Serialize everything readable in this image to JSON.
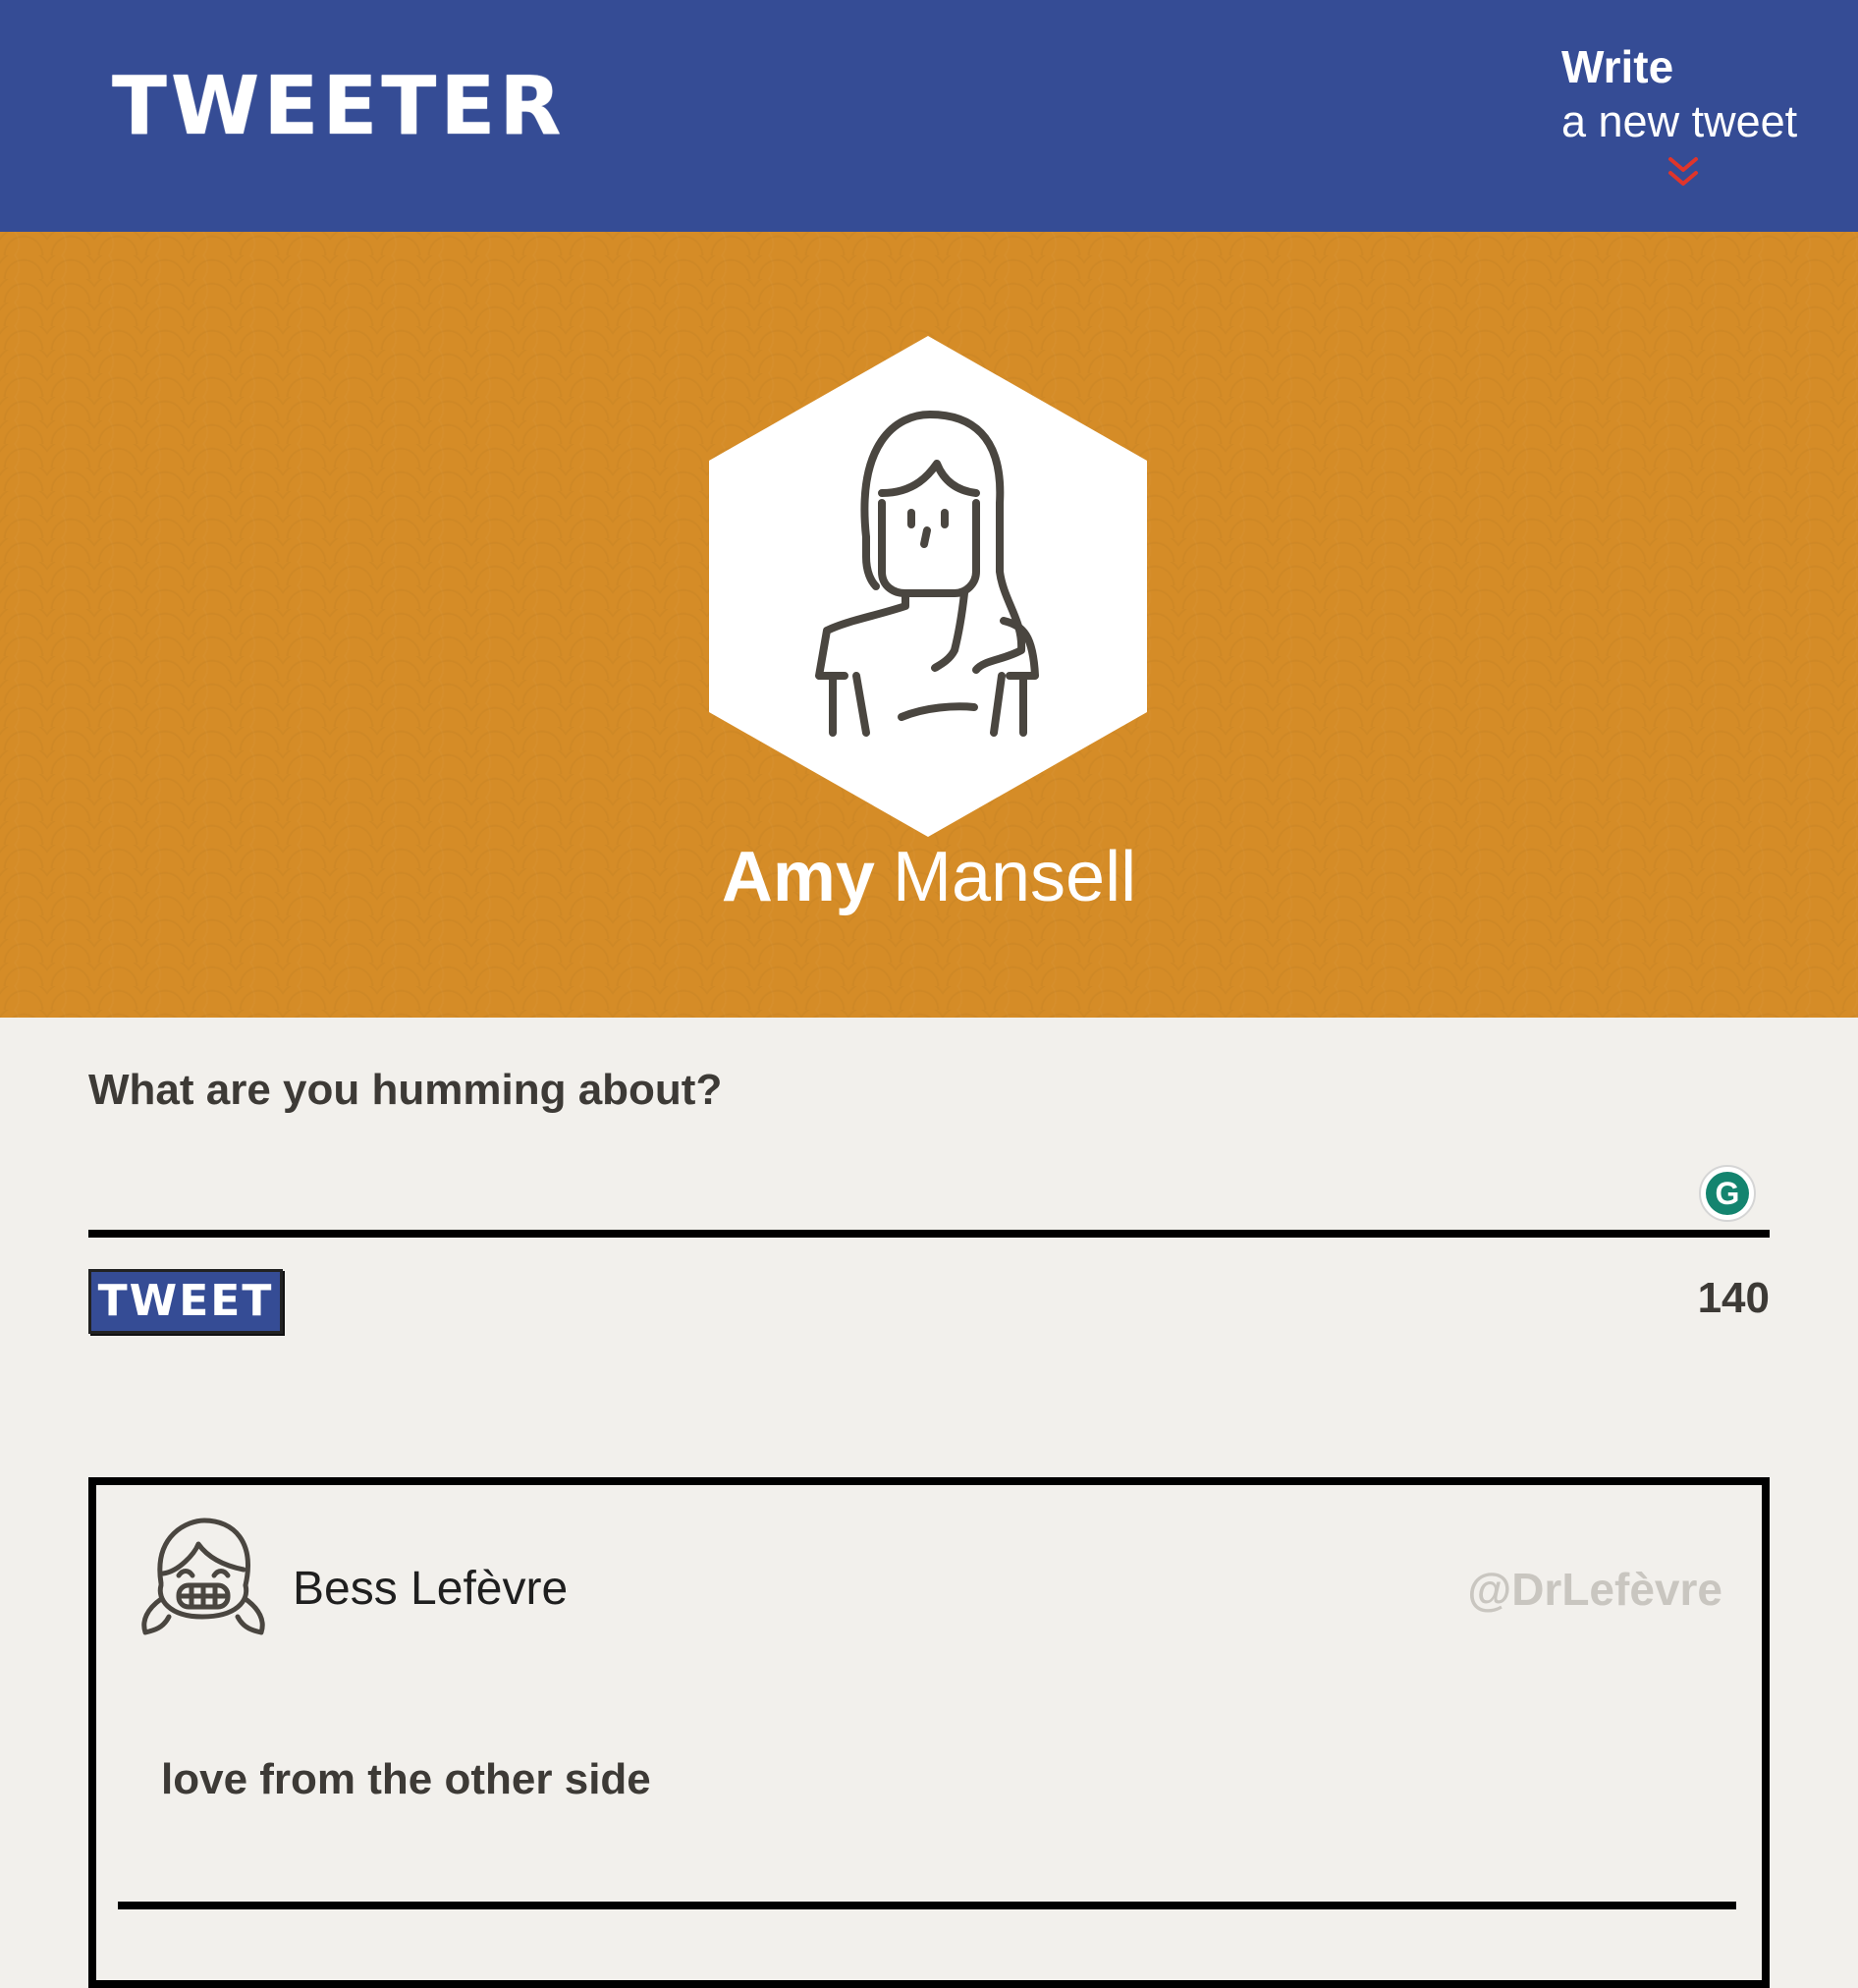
{
  "header": {
    "logo": "TWEETER",
    "write_title": "Write",
    "write_subtitle": "a new tweet",
    "chevron_icon": "double-chevron-down-icon",
    "chevron_color": "#e0352b",
    "background": "#354c95"
  },
  "profile": {
    "first_name": "Amy",
    "last_name": "Mansell",
    "avatar_icon": "woman-avatar-icon",
    "background": "#d58c27"
  },
  "compose": {
    "label": "What are you humming about?",
    "input_value": "",
    "grammarly_icon": "grammarly-icon",
    "grammarly_letter": "G",
    "tweet_button": "TWEET",
    "char_count": "140"
  },
  "tweets": [
    {
      "author_name": "Bess Lefèvre",
      "handle": "@DrLefèvre",
      "avatar_icon": "smiling-girl-avatar-icon",
      "text": "love from the other side"
    }
  ]
}
